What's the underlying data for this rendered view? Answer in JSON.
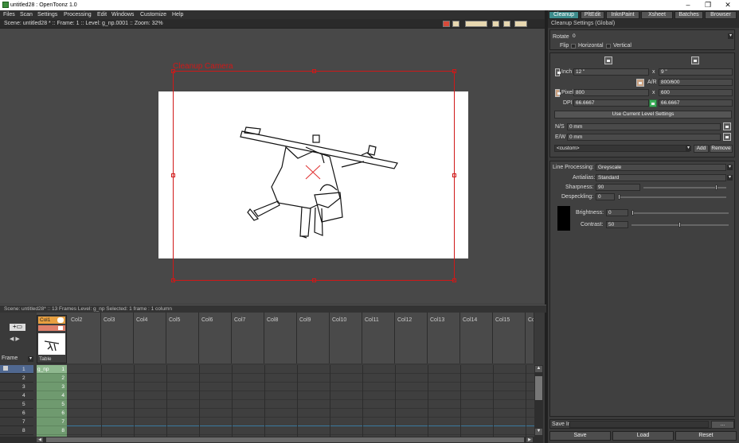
{
  "window": {
    "title": "untitled28 : OpenToonz 1.0",
    "min_icon": "minimize-icon",
    "max_icon": "maximize-icon",
    "close_icon": "close-icon"
  },
  "menu": {
    "items": [
      "Files",
      "Scan",
      "Settings",
      "Processing",
      "Edit",
      "Windows",
      "Customize",
      "Help"
    ]
  },
  "viewer": {
    "info": "Scene: untitled28 *  ::  Frame: 1  ::  Level: g_np.0001  ::  Zoom: 32%",
    "camera_label": "Cleanup  Camera"
  },
  "xsheet": {
    "header": "Scene: untitled28*  ::  13 Frames  Level: g_np  Selected: 1 frame : 1 column",
    "frame_label": "Frame",
    "col1": {
      "name": "Col1",
      "thumb_label": "Table"
    },
    "columns": [
      "Col2",
      "Col3",
      "Col4",
      "Col5",
      "Col6",
      "Col7",
      "Col8",
      "Col9",
      "Col10",
      "Col11",
      "Col12",
      "Col13",
      "Col14",
      "Col15",
      "Co"
    ],
    "frames": [
      "1",
      "2",
      "3",
      "4",
      "5",
      "6",
      "7",
      "8"
    ],
    "col1_cells": [
      {
        "level": "g_np",
        "num": "1"
      },
      {
        "level": "",
        "num": "2"
      },
      {
        "level": "",
        "num": "3"
      },
      {
        "level": "",
        "num": "4"
      },
      {
        "level": "",
        "num": "5"
      },
      {
        "level": "",
        "num": "6"
      },
      {
        "level": "",
        "num": "7"
      },
      {
        "level": "",
        "num": "8"
      }
    ]
  },
  "room_tabs": [
    "Cleanup",
    "PltEdit",
    "InknPaint",
    "Xsheet",
    "Batches",
    "Browser"
  ],
  "cleanup": {
    "panel_title": "Cleanup Settings (Global)",
    "rotate_label": "Rotate",
    "rotate_value": "0",
    "flip_label": "Flip",
    "horizontal_label": "Horizontal",
    "vertical_label": "Vertical",
    "unit_label": "Inch",
    "width_inch": "12 \"",
    "x_sep": "x",
    "height_inch": "9 \"",
    "ar_label": "A/R",
    "ar_value": "800/600",
    "pixel_label": "Pixel",
    "width_px": "800",
    "height_px": "600",
    "dpi_label": "DPI",
    "dpi_value": "66.6667",
    "dpi_value2": "66.6667",
    "use_current_btn": "Use Current Level Settings",
    "ns_label": "N/S",
    "ns_value": "0 mm",
    "ew_label": "E/W",
    "ew_value": "0 mm",
    "preset_value": "<custom>",
    "add_btn": "Add",
    "remove_btn": "Remove",
    "line_processing_label": "Line Processing:",
    "line_processing_value": "Greyscale",
    "antialias_label": "Antialias:",
    "antialias_value": "Standard",
    "sharpness_label": "Sharpness:",
    "sharpness_value": "90",
    "sharpness_level": 0.9,
    "despeckling_label": "Despeckling:",
    "despeckling_value": "0",
    "despeckling_level": 0.0,
    "brightness_label": "Brightness:",
    "brightness_value": "0",
    "brightness_level": 0.0,
    "contrast_label": "Contrast:",
    "contrast_value": "50",
    "contrast_level": 0.5,
    "save_in_label": "Save In",
    "browse_btn": "...",
    "save_btn": "Save",
    "load_btn": "Load",
    "reset_btn": "Reset"
  },
  "colors": {
    "camera_box": "#d01818",
    "active_tab": "#3d8c8c",
    "col1_cells": "#6f9a6f",
    "col1_header": "#e8a040"
  }
}
